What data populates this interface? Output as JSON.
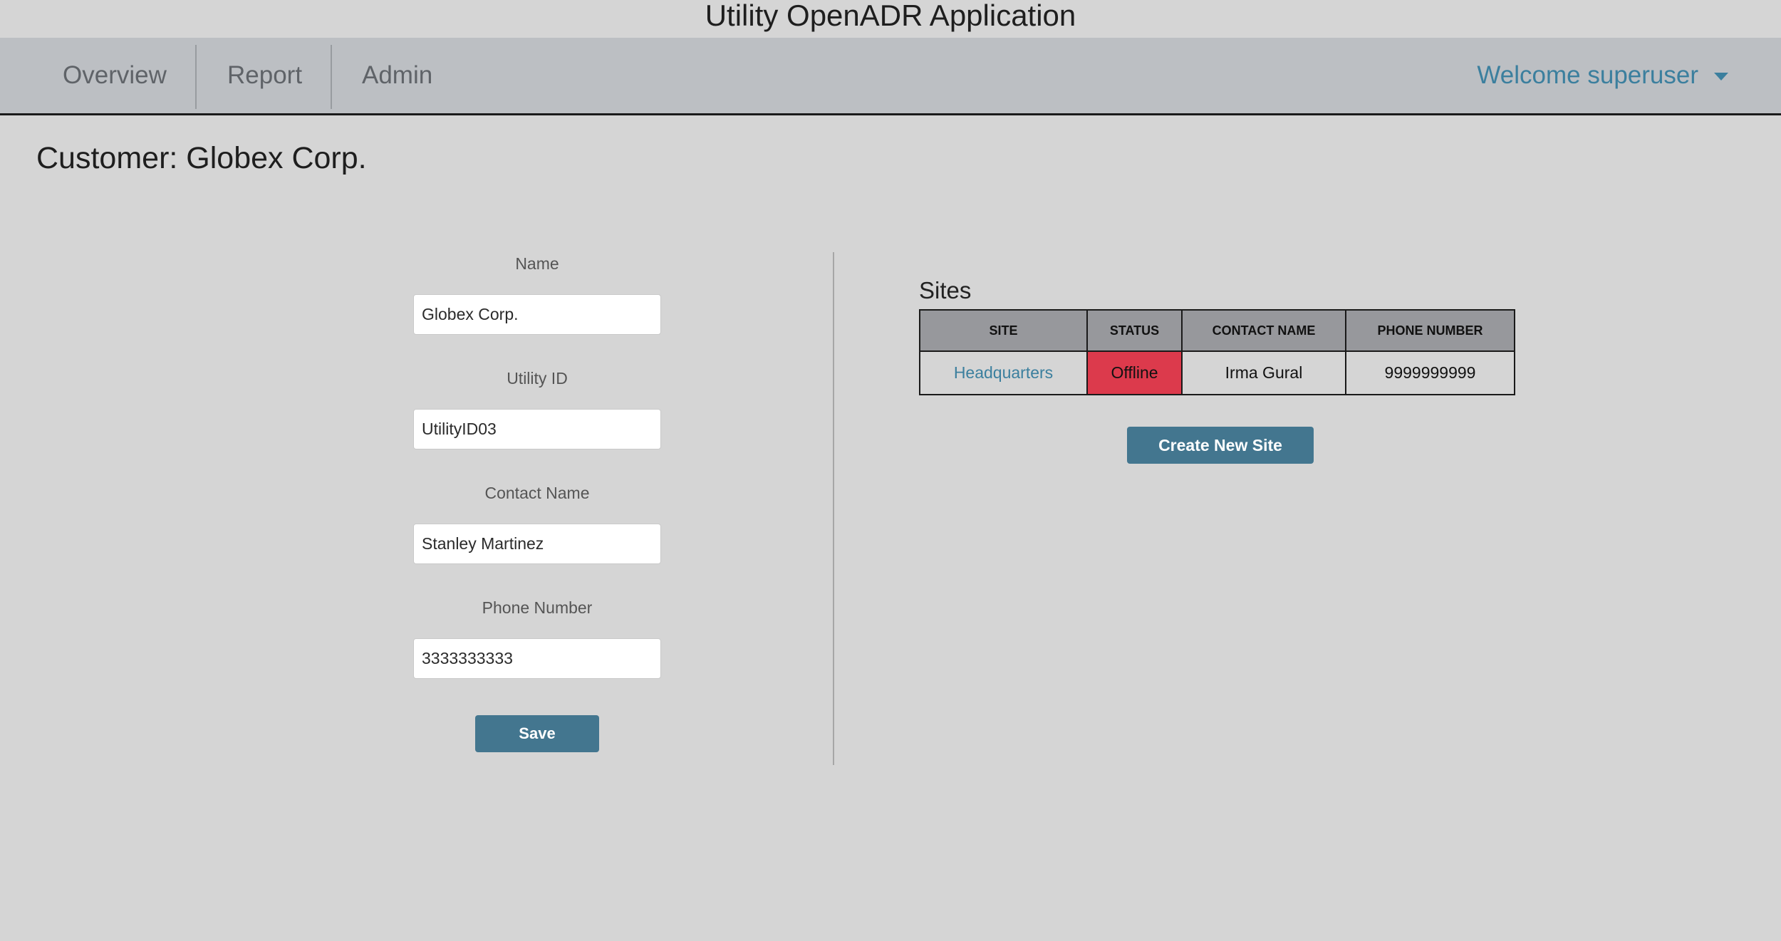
{
  "app": {
    "title": "Utility OpenADR Application"
  },
  "nav": {
    "items": [
      {
        "label": "Overview"
      },
      {
        "label": "Report"
      },
      {
        "label": "Admin"
      }
    ],
    "user_menu_label": "Welcome superuser"
  },
  "page": {
    "title": "Customer: Globex Corp."
  },
  "form": {
    "name_label": "Name",
    "name_value": "Globex Corp.",
    "utility_id_label": "Utility ID",
    "utility_id_value": "UtilityID03",
    "contact_name_label": "Contact Name",
    "contact_name_value": "Stanley Martinez",
    "phone_label": "Phone Number",
    "phone_value": "3333333333",
    "save_label": "Save"
  },
  "sites": {
    "heading": "Sites",
    "columns": [
      "SITE",
      "STATUS",
      "CONTACT NAME",
      "PHONE NUMBER"
    ],
    "rows": [
      {
        "site": "Headquarters",
        "status": "Offline",
        "contact_name": "Irma Gural",
        "phone_number": "9999999999"
      }
    ],
    "create_label": "Create New Site"
  },
  "colors": {
    "accent": "#43768f",
    "link": "#3b7f9e",
    "status_offline": "#dc3a4c",
    "navbar_bg": "#bcbfc3",
    "page_bg": "#d5d5d5"
  }
}
